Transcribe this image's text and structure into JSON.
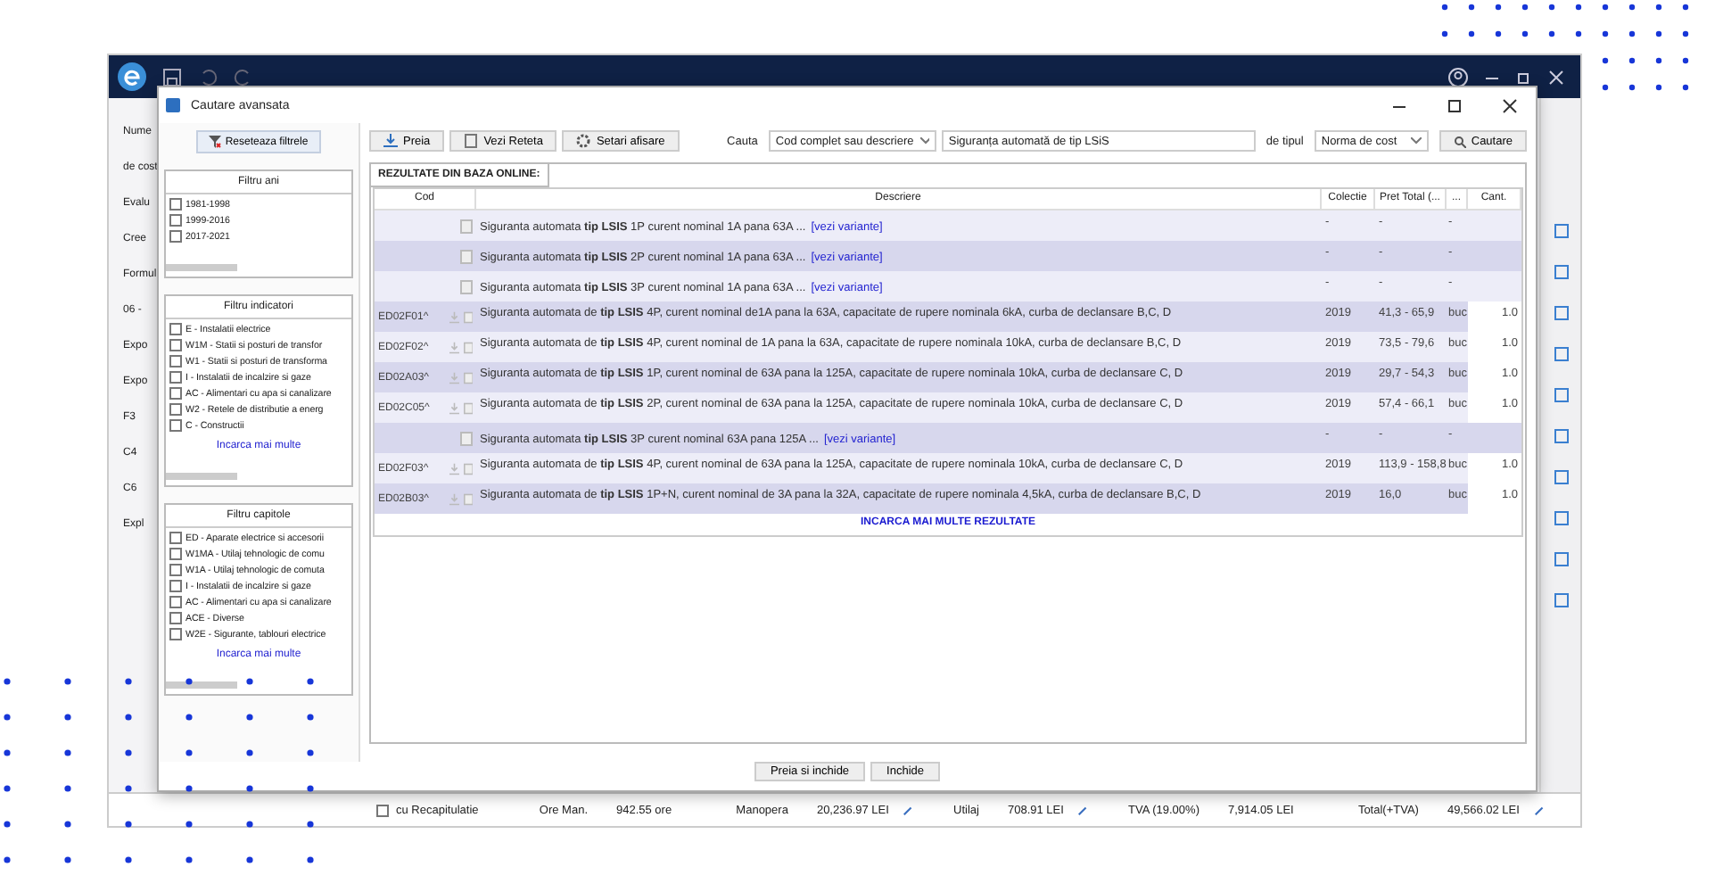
{
  "app": {
    "left_labels": [
      "Nume",
      "de cost",
      "Evalu",
      "Cree",
      "Formul",
      "06 -",
      "Expo",
      "Expo",
      "F3",
      "C4",
      "C6",
      "Expl"
    ],
    "status_bar": {
      "recap": {
        "label": "cu Recapitulatie",
        "checked": false
      },
      "items": [
        {
          "label": "Ore Man.",
          "value": "942.55 ore"
        },
        {
          "label": "Manopera",
          "value": "20,236.97 LEI",
          "editable": true
        },
        {
          "label": "Utilaj",
          "value": "708.91 LEI",
          "editable": true
        },
        {
          "label": "TVA (19.00%)",
          "value": "7,914.05 LEI"
        },
        {
          "label": "Total(+TVA)",
          "value": "49,566.02 LEI",
          "editable": true
        }
      ]
    }
  },
  "dialog": {
    "title": "Cautare avansata",
    "reset_button": "Reseteaza filtrele",
    "filters": [
      {
        "title": "Filtru ani",
        "items": [
          {
            "label": "1981-1998",
            "checked": false
          },
          {
            "label": "1999-2016",
            "checked": false
          },
          {
            "label": "2017-2021",
            "checked": false
          }
        ]
      },
      {
        "title": "Filtru indicatori",
        "items": [
          {
            "label": "E - Instalatii electrice",
            "checked": false
          },
          {
            "label": "W1M - Statii si posturi de transfor",
            "checked": false
          },
          {
            "label": "W1 - Statii si posturi de transforma",
            "checked": false
          },
          {
            "label": "I - Instalatii de incalzire si gaze",
            "checked": false
          },
          {
            "label": "AC - Alimentari cu apa si canalizare",
            "checked": false
          },
          {
            "label": "W2 - Retele de distributie a energ",
            "checked": false
          },
          {
            "label": "C - Constructii",
            "checked": false
          }
        ],
        "more": "Incarca mai multe"
      },
      {
        "title": "Filtru capitole",
        "items": [
          {
            "label": "ED - Aparate electrice si accesorii",
            "checked": false
          },
          {
            "label": "W1MA - Utilaj tehnologic de comu",
            "checked": false
          },
          {
            "label": "W1A - Utilaj tehnologic de comuta",
            "checked": false
          },
          {
            "label": "I - Instalatii de incalzire si gaze",
            "checked": false
          },
          {
            "label": "AC - Alimentari cu apa si canalizare",
            "checked": false
          },
          {
            "label": "ACE - Diverse",
            "checked": false
          },
          {
            "label": "W2E - Sigurante, tablouri electrice",
            "checked": false
          }
        ],
        "more": "Incarca mai multe"
      }
    ],
    "toolbar": [
      "Preia",
      "Vezi Reteta",
      "Setari afisare"
    ],
    "search_label": "Cauta",
    "search_mode": "Cod complet sau descriere",
    "search_value": "Siguranța automată de tip LSiS",
    "type_label": "de tipul",
    "type_value": "Norma de cost",
    "search_button": "Cautare",
    "results_tab": "REZULTATE DIN BAZA ONLINE:",
    "columns": [
      "Cod",
      "Descriere",
      "Colectie",
      "Pret Total (...",
      "...",
      "Cant."
    ],
    "rows": [
      {
        "kind": "group",
        "code": "",
        "description": "Siguranta automata **tip LSIS** 1P curent nominal 1A pana 63A ...",
        "link": "[vezi variante]",
        "collection": "-",
        "price": "-",
        "unit": "-",
        "qty": ""
      },
      {
        "kind": "group",
        "code": "",
        "description": "Siguranta automata **tip LSIS** 2P curent nominal 1A pana 63A ...",
        "link": "[vezi variante]",
        "collection": "-",
        "price": "-",
        "unit": "-",
        "qty": ""
      },
      {
        "kind": "group",
        "code": "",
        "description": "Siguranta automata **tip LSIS** 3P curent nominal 1A pana 63A ...",
        "link": "[vezi variante]",
        "collection": "-",
        "price": "-",
        "unit": "-",
        "qty": ""
      },
      {
        "kind": "item",
        "code": "ED02F01^",
        "description": "Siguranta automata de **tip LSIS** 4P, curent nominal de1A pana la 63A, capacitate de rupere nominala 6kA, curba de declansare B,C, D",
        "collection": "2019",
        "price": "41,3 - 65,9",
        "unit": "buc",
        "qty": "1.0"
      },
      {
        "kind": "item",
        "code": "ED02F02^",
        "description": "Siguranta automata de **tip LSIS** 4P, curent nominal de 1A pana la 63A, capacitate de rupere nominala 10kA, curba de declansare B,C, D",
        "collection": "2019",
        "price": "73,5 - 79,6",
        "unit": "buc",
        "qty": "1.0"
      },
      {
        "kind": "item",
        "code": "ED02A03^",
        "description": "Siguranta automata de **tip LSIS** 1P, curent nominal de 63A pana la 125A, capacitate de rupere nominala 10kA, curba de declansare C, D",
        "collection": "2019",
        "price": "29,7 - 54,3",
        "unit": "buc",
        "qty": "1.0"
      },
      {
        "kind": "item",
        "code": "ED02C05^",
        "description": "Siguranta automata de **tip LSIS** 2P, curent nominal de 63A pana la 125A, capacitate de rupere nominala 10kA, curba de declansare C, D",
        "collection": "2019",
        "price": "57,4 - 66,1",
        "unit": "buc",
        "qty": "1.0"
      },
      {
        "kind": "group",
        "code": "",
        "description": "Siguranta automata **tip LSIS** 3P curent nominal 63A pana 125A ...",
        "link": "[vezi variante]",
        "collection": "-",
        "price": "-",
        "unit": "-",
        "qty": ""
      },
      {
        "kind": "item",
        "code": "ED02F03^",
        "description": "Siguranta automata de **tip LSIS** 4P, curent nominal de 63A pana la 125A, capacitate de rupere nominala 10kA, curba de declansare C, D",
        "collection": "2019",
        "price": "113,9 - 158,8",
        "unit": "buc",
        "qty": "1.0"
      },
      {
        "kind": "item",
        "code": "ED02B03^",
        "description": "Siguranta automata de **tip LSIS** 1P+N, curent nominal de 3A pana la 32A, capacitate de rupere nominala 4,5kA, curba de declansare B,C, D",
        "collection": "2019",
        "price": "16,0",
        "unit": "buc",
        "qty": "1.0"
      }
    ],
    "load_more": "INCARCA MAI MULTE REZULTATE",
    "buttons": [
      "Preia si inchide",
      "Inchide"
    ]
  }
}
